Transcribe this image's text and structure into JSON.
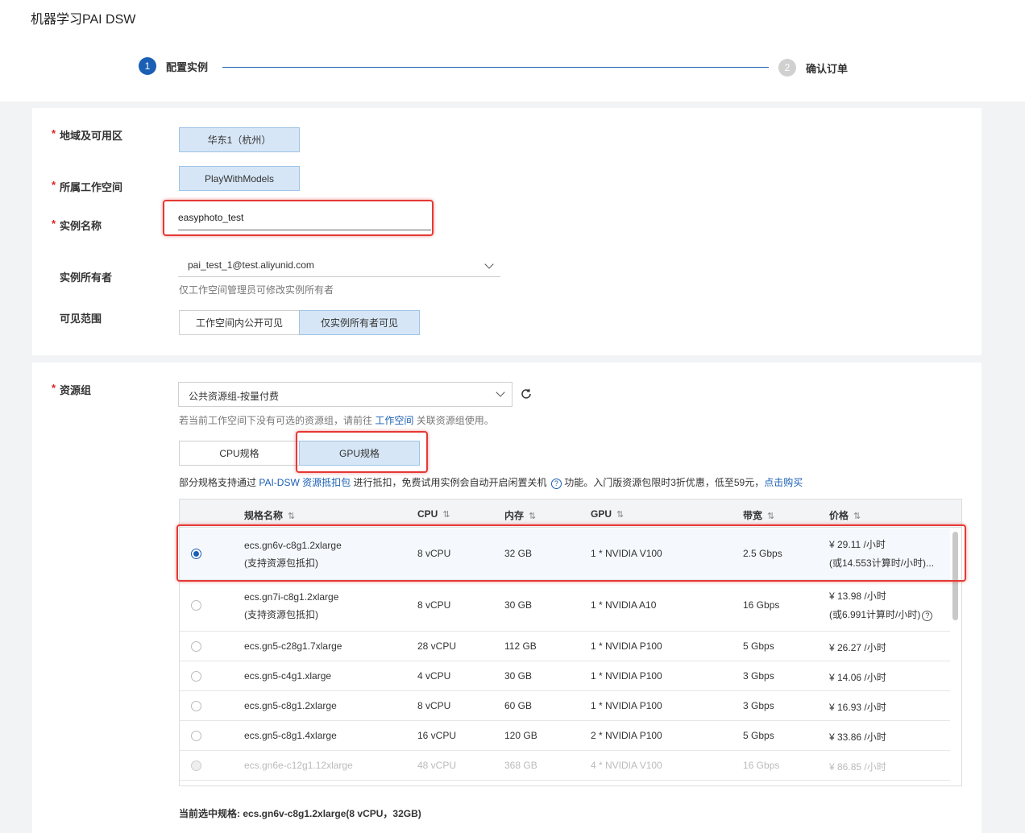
{
  "app": {
    "title": "机器学习PAI DSW"
  },
  "steps": [
    {
      "num": "1",
      "label": "配置实例"
    },
    {
      "num": "2",
      "label": "确认订单"
    }
  ],
  "form": {
    "region_label": "地域及可用区",
    "region_value": "华东1（杭州）",
    "workspace_label": "所属工作空间",
    "workspace_value": "PlayWithModels",
    "name_label": "实例名称",
    "name_value": "easyphoto_test",
    "owner_label": "实例所有者",
    "owner_value": "pai_test_1@test.aliyunid.com",
    "owner_hint": "仅工作空间管理员可修改实例所有者",
    "visibility_label": "可见范围",
    "visibility_options": [
      "工作空间内公开可见",
      "仅实例所有者可见"
    ]
  },
  "resource": {
    "label": "资源组",
    "select_value": "公共资源组-按量付费",
    "hint_prefix": "若当前工作空间下没有可选的资源组，请前往",
    "hint_link": "工作空间",
    "hint_suffix": "关联资源组使用。",
    "tabs": [
      "CPU规格",
      "GPU规格"
    ],
    "promo_prefix": "部分规格支持通过",
    "promo_link1": "PAI-DSW 资源抵扣包",
    "promo_middle": "进行抵扣，免费试用实例会自动开启闲置关机",
    "promo_suffix": "功能。入门版资源包限时3折优惠，低至59元，",
    "promo_link2": "点击购买"
  },
  "table": {
    "headers": [
      "规格名称",
      "CPU",
      "内存",
      "GPU",
      "带宽",
      "价格"
    ],
    "sort_glyph": "⇅",
    "rows": [
      {
        "name": "ecs.gn6v-c8g1.2xlarge",
        "note": "(支持资源包抵扣)",
        "cpu": "8 vCPU",
        "mem": "32 GB",
        "gpu": "1 * NVIDIA V100",
        "bw": "2.5 Gbps",
        "price": "¥ 29.11 /小时",
        "price2": "(或14.553计算时/小时)...",
        "selected": true
      },
      {
        "name": "ecs.gn7i-c8g1.2xlarge",
        "note": "(支持资源包抵扣)",
        "cpu": "8 vCPU",
        "mem": "30 GB",
        "gpu": "1 * NVIDIA A10",
        "bw": "16 Gbps",
        "price": "¥ 13.98 /小时",
        "price2": "(或6.991计算时/小时)"
      },
      {
        "name": "ecs.gn5-c28g1.7xlarge",
        "cpu": "28 vCPU",
        "mem": "112 GB",
        "gpu": "1 * NVIDIA P100",
        "bw": "5 Gbps",
        "price": "¥ 26.27 /小时"
      },
      {
        "name": "ecs.gn5-c4g1.xlarge",
        "cpu": "4 vCPU",
        "mem": "30 GB",
        "gpu": "1 * NVIDIA P100",
        "bw": "3 Gbps",
        "price": "¥ 14.06 /小时"
      },
      {
        "name": "ecs.gn5-c8g1.2xlarge",
        "cpu": "8 vCPU",
        "mem": "60 GB",
        "gpu": "1 * NVIDIA P100",
        "bw": "3 Gbps",
        "price": "¥ 16.93 /小时"
      },
      {
        "name": "ecs.gn5-c8g1.4xlarge",
        "cpu": "16 vCPU",
        "mem": "120 GB",
        "gpu": "2 * NVIDIA P100",
        "bw": "5 Gbps",
        "price": "¥ 33.86 /小时"
      },
      {
        "name": "ecs.gn6e-c12g1.12xlarge",
        "cpu": "48 vCPU",
        "mem": "368 GB",
        "gpu": "4 * NVIDIA V100",
        "bw": "16 Gbps",
        "price": "¥ 86.85 /小时",
        "disabled": true
      }
    ]
  },
  "footer": {
    "current_spec": "当前选中规格: ecs.gn6v-c8g1.2xlarge(8 vCPU，32GB)"
  }
}
